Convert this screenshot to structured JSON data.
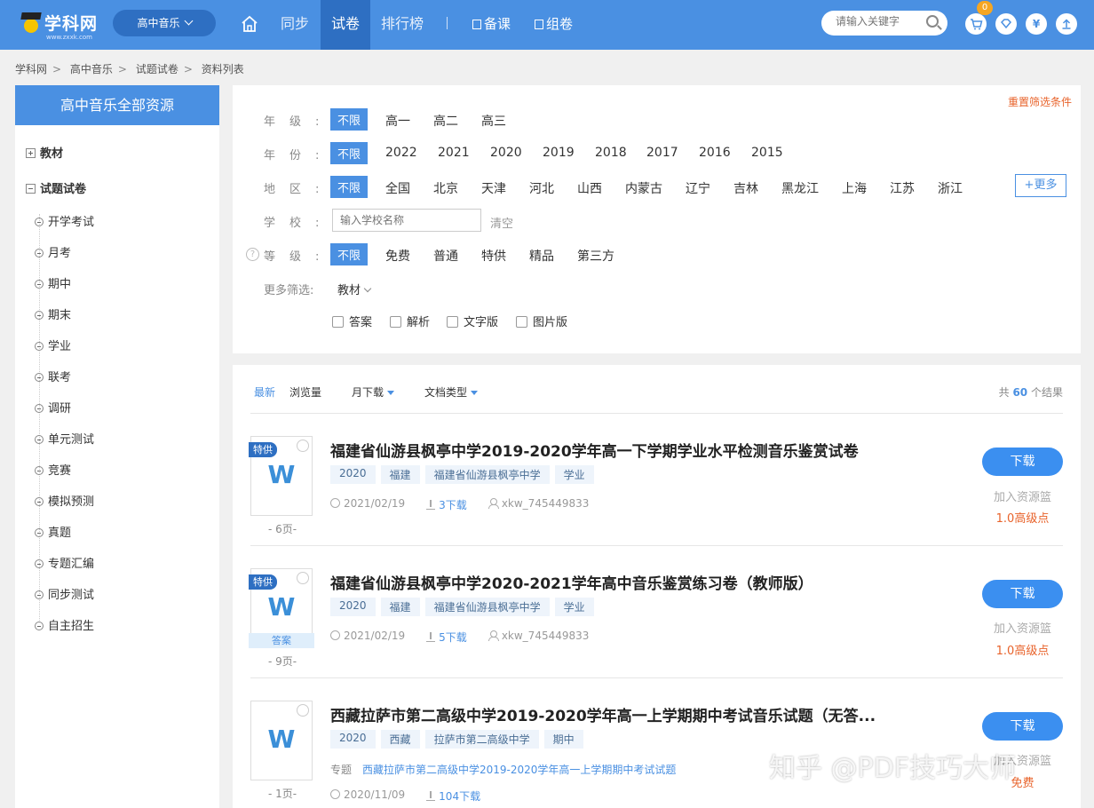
{
  "header": {
    "logo_text": "学科网",
    "logo_sub": "www.zxxk.com",
    "subject": "高中音乐",
    "nav": [
      "同步",
      "试卷",
      "排行榜"
    ],
    "nav_active": "试卷",
    "nav_tools": [
      "备课",
      "组卷"
    ],
    "search_placeholder": "请输入关键字",
    "cart_count": "0",
    "brand_color": "#4a90e2"
  },
  "breadcrumb": [
    "学科网",
    "高中音乐",
    "试题试卷",
    "资料列表"
  ],
  "sidebar": {
    "title": "高中音乐全部资源",
    "sections": [
      {
        "label": "教材",
        "icon": "plus-box-icon"
      },
      {
        "label": "试题试卷",
        "icon": "minus-box-icon"
      }
    ],
    "items": [
      "开学考试",
      "月考",
      "期中",
      "期末",
      "学业",
      "联考",
      "调研",
      "单元测试",
      "竞赛",
      "模拟预测",
      "真题",
      "专题汇编",
      "同步测试",
      "自主招生"
    ]
  },
  "filter": {
    "reset": "重置筛选条件",
    "grade_label": "年级:",
    "grade_options": [
      "不限",
      "高一",
      "高二",
      "高三"
    ],
    "year_label": "年份:",
    "year_options": [
      "不限",
      "2022",
      "2021",
      "2020",
      "2019",
      "2018",
      "2017",
      "2016",
      "2015"
    ],
    "region_label": "地区:",
    "region_options": [
      "不限",
      "全国",
      "北京",
      "天津",
      "河北",
      "山西",
      "内蒙古",
      "辽宁",
      "吉林",
      "黑龙江",
      "上海",
      "江苏",
      "浙江"
    ],
    "more": "+更多",
    "school_label": "学校:",
    "school_placeholder": "输入学校名称",
    "clear": "清空",
    "level_label": "等级:",
    "level_options": [
      "不限",
      "免费",
      "普通",
      "特供",
      "精品",
      "第三方"
    ],
    "more_filter_label": "更多筛选:",
    "more_filter_value": "教材",
    "checkboxes": [
      "答案",
      "解析",
      "文字版",
      "图片版"
    ]
  },
  "results": {
    "sort": [
      "最新",
      "浏览量",
      "月下载",
      "文档类型"
    ],
    "total_prefix": "共",
    "total": "60",
    "total_suffix": "个结果",
    "items": [
      {
        "badge": "特供",
        "icon_letter": "W",
        "pages": "- 6页-",
        "title": "福建省仙游县枫亭中学2019-2020学年高一下学期学业水平检测音乐鉴赏试卷",
        "tags": [
          "2020",
          "福建",
          "福建省仙游县枫亭中学",
          "学业"
        ],
        "date": "2021/02/19",
        "downloads": "3下载",
        "user": "xkw_745449833",
        "button": "下载",
        "basket": "加入资源篮",
        "price": "1.0高级点"
      },
      {
        "badge": "特供",
        "icon_letter": "W",
        "answer": "答案",
        "pages": "- 9页-",
        "title": "福建省仙游县枫亭中学2020-2021学年高中音乐鉴赏练习卷（教师版）",
        "tags": [
          "2020",
          "福建",
          "福建省仙游县枫亭中学",
          "学业"
        ],
        "date": "2021/02/19",
        "downloads": "5下载",
        "user": "xkw_745449833",
        "button": "下载",
        "basket": "加入资源篮",
        "price": "1.0高级点"
      },
      {
        "icon_letter": "W",
        "pages": "- 1页-",
        "title": "西藏拉萨市第二高级中学2019-2020学年高一上学期期中考试音乐试题（无答...",
        "tags": [
          "2020",
          "西藏",
          "拉萨市第二高级中学",
          "期中"
        ],
        "special_label": "专题",
        "special_link": "西藏拉萨市第二高级中学2019-2020学年高一上学期期中考试试题",
        "date": "2020/11/09",
        "downloads": "104下载",
        "button": "下载",
        "basket": "加入资源篮",
        "price": "免费"
      }
    ]
  },
  "watermark": "知乎 @PDF技巧大师"
}
